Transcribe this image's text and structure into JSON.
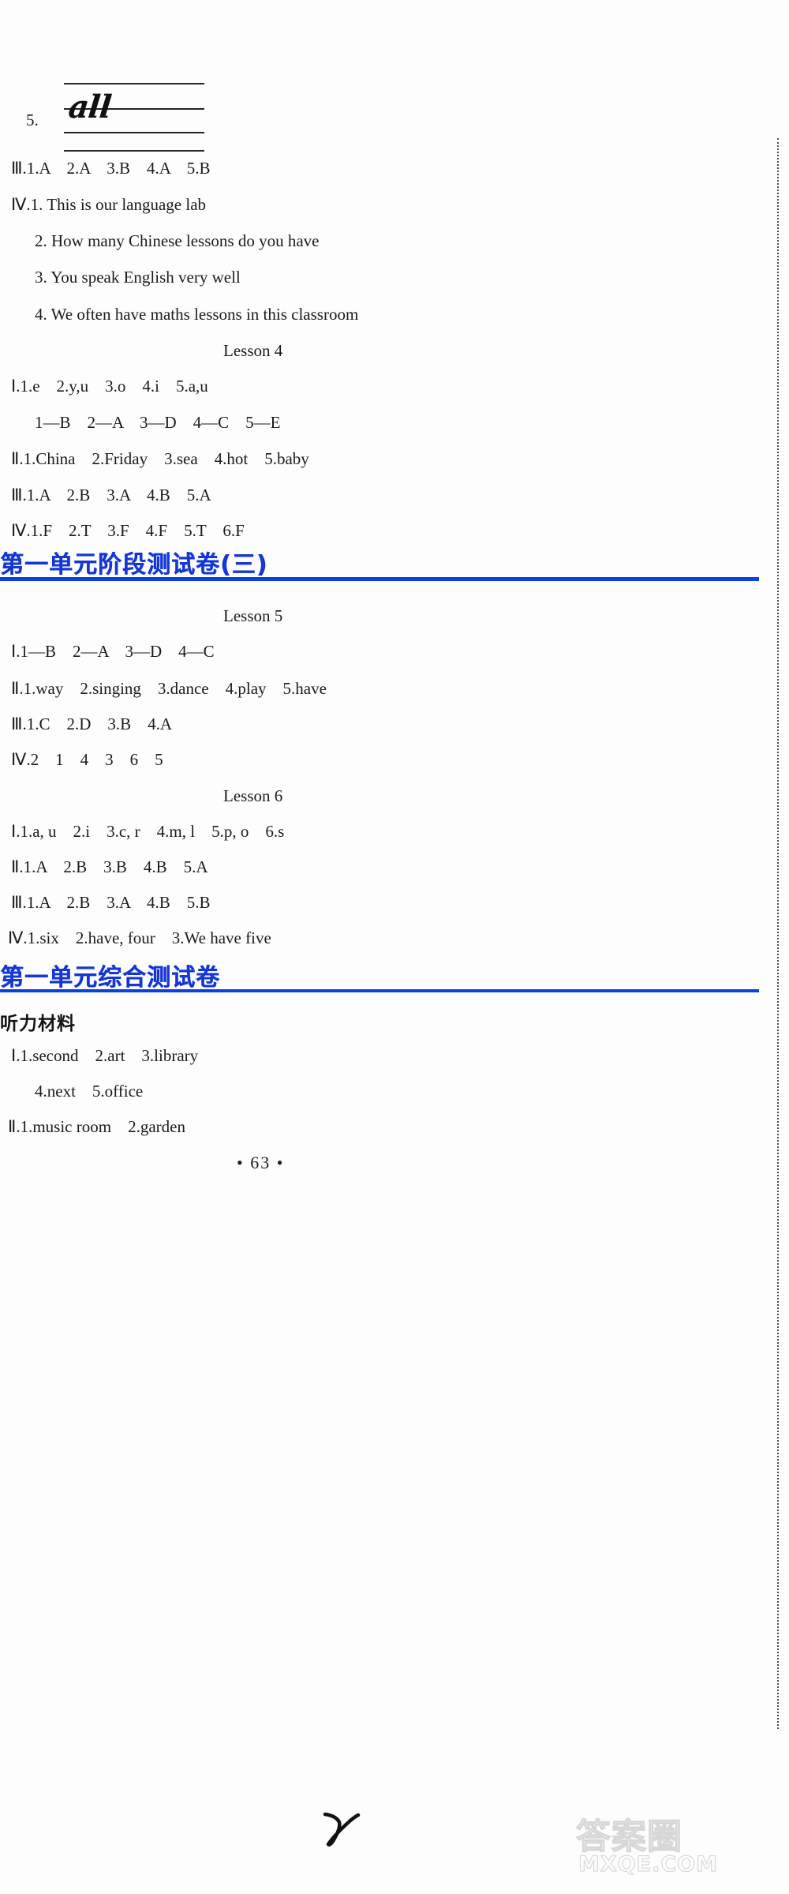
{
  "document": {
    "page_number": "• 63 •",
    "handwriting_exercise": {
      "number": "5.",
      "written_word": "all"
    },
    "watermark": {
      "chinese": "答案圈",
      "english": "MXQE.COM"
    },
    "sections": [
      {
        "id": "lesson-3-tail",
        "answers": [
          {
            "id": "l3-III",
            "text": "Ⅲ.1.A　2.A　3.B　4.A　5.B",
            "indent": 0
          },
          {
            "id": "l3-IV-1",
            "text": "Ⅳ.1. This is our language lab",
            "indent": 0
          },
          {
            "id": "l3-IV-2",
            "text": "2. How many Chinese lessons do you have",
            "indent": 1
          },
          {
            "id": "l3-IV-3",
            "text": "3. You speak English very well",
            "indent": 1
          },
          {
            "id": "l3-IV-4",
            "text": "4. We often have maths lessons in this classroom",
            "indent": 1
          }
        ]
      },
      {
        "id": "lesson-4",
        "lesson_label": "Lesson 4",
        "answers": [
          {
            "id": "l4-I",
            "text": "Ⅰ.1.e　2.y,u　3.o　4.i　5.a,u",
            "indent": 0
          },
          {
            "id": "l4-I-match",
            "text": "1—B　2—A　3—D　4—C　5—E",
            "indent": 1
          },
          {
            "id": "l4-II",
            "text": "Ⅱ.1.China　2.Friday　3.sea　4.hot　5.baby",
            "indent": 0
          },
          {
            "id": "l4-III",
            "text": "Ⅲ.1.A　2.B　3.A　4.B　5.A",
            "indent": 0
          },
          {
            "id": "l4-IV",
            "text": "Ⅳ.1.F　2.T　3.F　4.F　5.T　6.F",
            "indent": 0
          }
        ]
      },
      {
        "id": "unit-1-stage-test-3",
        "heading": "第一单元阶段测试卷(三)",
        "lesson_label": "Lesson 5",
        "answers": [
          {
            "id": "l5-I",
            "text": "Ⅰ.1—B　2—A　3—D　4—C",
            "indent": 0
          },
          {
            "id": "l5-II",
            "text": "Ⅱ.1.way　2.singing　3.dance　4.play　5.have",
            "indent": 0
          },
          {
            "id": "l5-III",
            "text": "Ⅲ.1.C　2.D　3.B　4.A",
            "indent": 0
          },
          {
            "id": "l5-IV",
            "text": "Ⅳ.2　1　4　3　6　5",
            "indent": 0
          }
        ]
      },
      {
        "id": "lesson-6",
        "lesson_label": "Lesson 6",
        "answers": [
          {
            "id": "l6-I",
            "text": "Ⅰ.1.a, u　2.i　3.c, r　4.m, l　5.p, o　6.s",
            "indent": 0
          },
          {
            "id": "l6-II",
            "text": "Ⅱ.1.A　2.B　3.B　4.B　5.A",
            "indent": 0
          },
          {
            "id": "l6-III",
            "text": "Ⅲ.1.A　2.B　3.A　4.B　5.B",
            "indent": 0
          },
          {
            "id": "l6-IV",
            "text": "Ⅳ.1.six　2.have, four　3.We have five",
            "indent": 0
          }
        ]
      },
      {
        "id": "unit-1-comprehensive-test",
        "heading": "第一单元综合测试卷",
        "subheading": "听力材料",
        "answers": [
          {
            "id": "c1-I-a",
            "text": "Ⅰ.1.second　2.art　3.library",
            "indent": 0
          },
          {
            "id": "c1-I-b",
            "text": "4.next　5.office",
            "indent": 1
          },
          {
            "id": "c1-II",
            "text": "Ⅱ.1.music room　2.garden",
            "indent": 0
          }
        ]
      }
    ]
  }
}
